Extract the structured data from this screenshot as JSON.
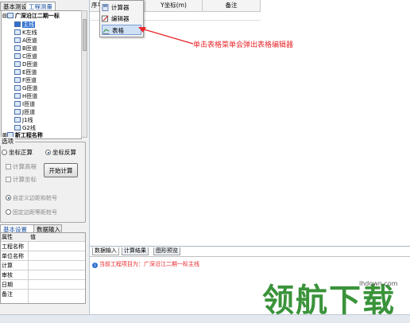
{
  "left_tabs": [
    "基本测设",
    "工程测量"
  ],
  "tree": {
    "root": "广深沿江二期一标",
    "items": [
      "主线",
      "K左线",
      "A匝道",
      "B匝道",
      "C匝道",
      "D匝道",
      "E匝道",
      "F匝道",
      "G匝道",
      "H匝道",
      "I匝道",
      "J匝道",
      "J1线",
      "G2线"
    ],
    "root2": "新工程名称"
  },
  "options": {
    "group_label": "选项",
    "radio_forward": "坐标正算",
    "radio_inverse": "坐标反算",
    "chk_elevation": "计算高程",
    "chk_coords": "计算坐标",
    "calc_button": "开始计算",
    "radio_custom": "自定义边距和桩号",
    "radio_fixed": "固定边距等距桩号"
  },
  "prop_tabs": [
    "基本设置",
    "数据输入"
  ],
  "prop_table": {
    "header": [
      "属性",
      "值"
    ],
    "rows": [
      "工程名称",
      "单位名称",
      "计算",
      "审核",
      "日期",
      "备注"
    ]
  },
  "grid_headers": [
    "序号",
    "",
    "Y坐标(m)",
    "备注"
  ],
  "context_menu": [
    "计算器",
    "编辑器",
    "表格"
  ],
  "annotation": "单击表格菜单会弹出表格编辑器",
  "bottom_tabs": [
    "数据输入",
    "计算结果",
    "图形预览"
  ],
  "message": "当前工程项目为：广深沿江二期一标主线",
  "watermark": "领航下载",
  "watermark_url": "lhdown.com",
  "colors": {
    "accent": "#2f6fd0",
    "annotation": "#e8262a",
    "watermark": "#2a8a2a"
  }
}
